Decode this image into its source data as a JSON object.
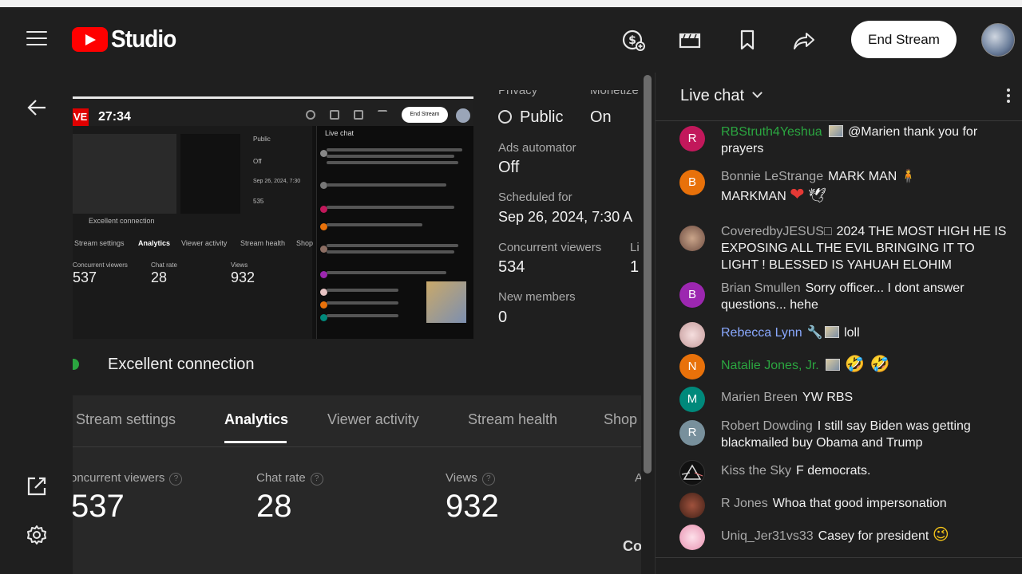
{
  "app": {
    "logo_text": "Studio",
    "end_stream_label": "End Stream"
  },
  "header_icons": [
    "monetization-icon",
    "clapperboard-icon",
    "bookmark-icon",
    "share-icon"
  ],
  "preview": {
    "live_label": "VE",
    "timer": "27:34",
    "mini_end_label": "End Stream",
    "mini_chat_title": "Live chat",
    "mini_tabs": [
      "Stream settings",
      "Analytics",
      "Viewer activity",
      "Stream health",
      "Shop"
    ],
    "mini_metrics": [
      "537",
      "28",
      "932"
    ],
    "mini_metric_labels": [
      "Concurrent viewers",
      "Chat rate",
      "Views"
    ],
    "mini_connection": "Excellent connection",
    "mini_info": [
      "Public",
      "On",
      "Off",
      "Sep 26, 2024, 7:30",
      "535",
      "0"
    ]
  },
  "info": {
    "privacy_label": "Privacy",
    "privacy_value": "Public",
    "monetize_label": "Monetize",
    "monetize_value": "On",
    "ads_label": "Ads automator",
    "ads_value": "Off",
    "scheduled_label": "Scheduled for",
    "scheduled_value": "Sep 26, 2024, 7:30 A",
    "concurrent_label": "Concurrent viewers",
    "concurrent_value": "534",
    "likes_label": "Li",
    "likes_value": "1",
    "members_label": "New members",
    "members_value": "0"
  },
  "connection": {
    "text": "Excellent connection",
    "color": "#2ba640"
  },
  "tabs": [
    "Stream settings",
    "Analytics",
    "Viewer activity",
    "Stream health",
    "Shop"
  ],
  "active_tab": "Analytics",
  "metrics": [
    {
      "label": "oncurrent viewers",
      "value": "537"
    },
    {
      "label": "Chat rate",
      "value": "28"
    },
    {
      "label": "Views",
      "value": "932"
    }
  ],
  "metrics_extra": {
    "partial_label": "A",
    "partial_value": "'",
    "co_text": "Co"
  },
  "chat": {
    "title": "Live chat",
    "messages": [
      {
        "initial": "R",
        "color": "#c2185b",
        "author": "RBStruth4Yeshua",
        "text": "@Marien thank you for prayers"
      },
      {
        "initial": "B",
        "color": "#e8710a",
        "author": "Bonnie LeStrange",
        "text": "MARK MAN"
      },
      {
        "initial": "",
        "color": "#8d6e63",
        "author": "CoveredbyJESUS",
        "text": "2024 THE MOST HIGH HE IS EXPOSING ALL THE EVIL BRINGING IT TO LIGHT ! BLESSED IS YAHUAH ELOHIM"
      },
      {
        "initial": "B",
        "color": "#9c27b0",
        "author": "Brian Smullen",
        "text": "Sorry officer... I dont answer questions... hehe"
      },
      {
        "initial": "",
        "color": "#e8c4c4",
        "author": "Rebecca Lynn",
        "text": "loll"
      },
      {
        "initial": "N",
        "color": "#e8710a",
        "author": "Natalie Jones, Jr.",
        "text": ""
      },
      {
        "initial": "M",
        "color": "#00897b",
        "author": "Marien Breen",
        "text": "YW RBS"
      },
      {
        "initial": "R",
        "color": "#78909c",
        "author": "Robert Dowding",
        "text": "I still say Biden was getting blackmailed buy Obama and Trump"
      },
      {
        "initial": "",
        "color": "#111111",
        "author": "Kiss the Sky",
        "text": "F democrats."
      },
      {
        "initial": "",
        "color": "#7b3f2e",
        "author": "R Jones",
        "text": "Whoa that good impersonation"
      },
      {
        "initial": "",
        "color": "#f8bbd0",
        "author": "Uniq_Jer31vs33",
        "text": "Casey for president"
      }
    ],
    "extra": {
      "mark_man_2": "MARKMAN",
      "emoji_heart": "❤",
      "emoji_dove": "🕊",
      "emoji_person": "🧍",
      "emoji_rofl": "🤣 🤣",
      "emoji_wink": "😉",
      "emoji_wrench": "🔧",
      "covered_suffix": "□"
    }
  }
}
